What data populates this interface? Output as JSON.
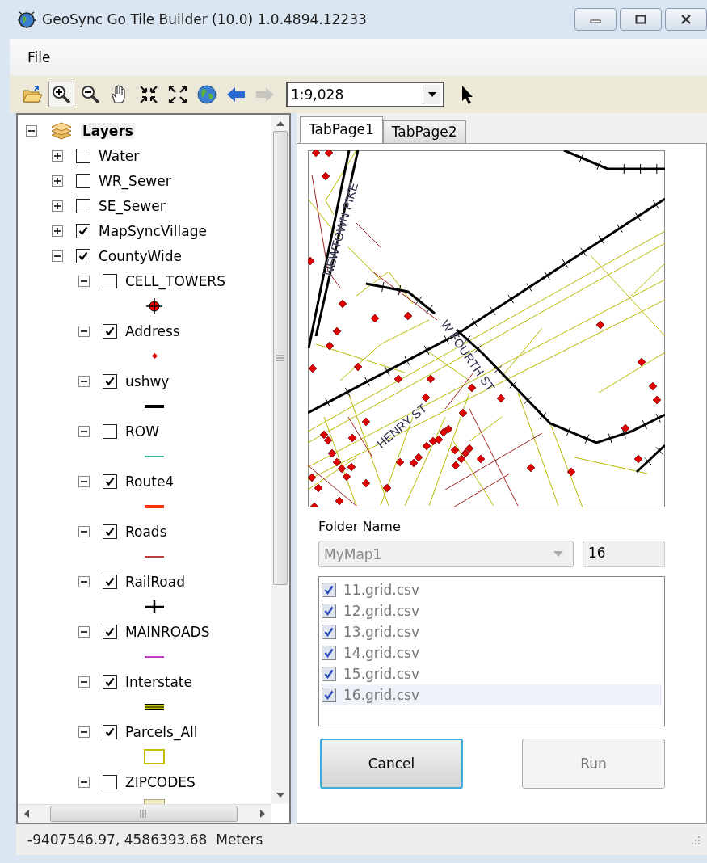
{
  "window": {
    "title": "GeoSync Go Tile Builder (10.0) 1.0.4894.12233"
  },
  "menu": [
    {
      "label": "File"
    }
  ],
  "toolbar": {
    "tools": [
      {
        "kind": "open",
        "selected": false,
        "disabled": false
      },
      {
        "kind": "zoom-in",
        "selected": true,
        "disabled": false
      },
      {
        "kind": "zoom-out",
        "selected": false,
        "disabled": false
      },
      {
        "kind": "pan",
        "selected": false,
        "disabled": false
      },
      {
        "kind": "fixed-zoom-in",
        "selected": false,
        "disabled": false
      },
      {
        "kind": "fixed-zoom-out",
        "selected": false,
        "disabled": false
      },
      {
        "kind": "full-extent",
        "selected": false,
        "disabled": false
      },
      {
        "kind": "back",
        "selected": false,
        "disabled": false
      },
      {
        "kind": "forward",
        "selected": false,
        "disabled": true
      }
    ],
    "scale": "1:9,028",
    "after": [
      {
        "kind": "select",
        "selected": false,
        "disabled": false
      }
    ]
  },
  "tree": {
    "label": "Layers",
    "expanded": true,
    "children": [
      {
        "label": "Water",
        "checked": false,
        "expanded": false
      },
      {
        "label": "WR_Sewer",
        "checked": false,
        "expanded": false
      },
      {
        "label": "SE_Sewer",
        "checked": false,
        "expanded": false
      },
      {
        "label": "MapSyncVillage",
        "checked": true,
        "expanded": false
      },
      {
        "label": "CountyWide",
        "checked": true,
        "expanded": true,
        "children": [
          {
            "label": "CELL_TOWERS",
            "checked": false,
            "expanded": true,
            "symbol": {
              "kind": "marker",
              "color": "#ff0000"
            }
          },
          {
            "label": "Address",
            "checked": true,
            "expanded": true,
            "symbol": {
              "kind": "point",
              "color": "#e00000"
            }
          },
          {
            "label": "ushwy",
            "checked": true,
            "expanded": true,
            "symbol": {
              "kind": "thick-line",
              "color": "#000000"
            }
          },
          {
            "label": "ROW",
            "checked": false,
            "expanded": true,
            "symbol": {
              "kind": "line",
              "color": "#30b090"
            }
          },
          {
            "label": "Route4",
            "checked": true,
            "expanded": true,
            "symbol": {
              "kind": "thick-line",
              "color": "#ff3010"
            }
          },
          {
            "label": "Roads",
            "checked": true,
            "expanded": true,
            "symbol": {
              "kind": "line",
              "color": "#c04040"
            }
          },
          {
            "label": "RailRoad",
            "checked": true,
            "expanded": true,
            "symbol": {
              "kind": "rail",
              "color": "#000000"
            }
          },
          {
            "label": "MAINROADS",
            "checked": true,
            "expanded": true,
            "symbol": {
              "kind": "line",
              "color": "#c040c0"
            }
          },
          {
            "label": "Interstate",
            "checked": true,
            "expanded": true,
            "symbol": {
              "kind": "double-line",
              "color": "#c8c800"
            }
          },
          {
            "label": "Parcels_All",
            "checked": true,
            "expanded": true,
            "symbol": {
              "kind": "polygon",
              "color": "#c0c000"
            }
          },
          {
            "label": "ZIPCODES",
            "checked": false,
            "expanded": true,
            "symbol": {
              "kind": "filled-polygon",
              "color": "#f0ecc0"
            }
          }
        ]
      }
    ]
  },
  "tabs": [
    {
      "label": "TabPage1",
      "selected": true
    },
    {
      "label": "TabPage2",
      "selected": false
    }
  ],
  "map": {
    "labels": [
      {
        "text": "NEWTOWN PIKE"
      },
      {
        "text": "W FOURTH ST"
      },
      {
        "text": "HENRY ST"
      }
    ]
  },
  "folder": {
    "label": "Folder Name",
    "combo": {
      "value": "MyMap1",
      "disabled": true
    },
    "count": "16"
  },
  "files": [
    {
      "name": "11.grid.csv",
      "checked": true,
      "selected": false
    },
    {
      "name": "12.grid.csv",
      "checked": true,
      "selected": false
    },
    {
      "name": "13.grid.csv",
      "checked": true,
      "selected": false
    },
    {
      "name": "14.grid.csv",
      "checked": true,
      "selected": false
    },
    {
      "name": "15.grid.csv",
      "checked": true,
      "selected": false
    },
    {
      "name": "16.grid.csv",
      "checked": true,
      "selected": true
    }
  ],
  "buttons": [
    {
      "label": "Cancel",
      "focused": true,
      "disabled": false
    },
    {
      "label": "Run",
      "focused": false,
      "disabled": true
    }
  ],
  "status_bar": {
    "text": "-9407546.97, 4586393.68  Meters"
  }
}
